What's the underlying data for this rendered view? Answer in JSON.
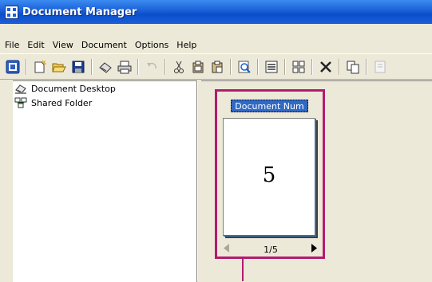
{
  "window": {
    "title": "Document Manager"
  },
  "menubar": {
    "items": [
      "File",
      "Edit",
      "View",
      "Document",
      "Options",
      "Help"
    ]
  },
  "toolbar": {
    "buttons": [
      {
        "icon": "app-blue-icon"
      },
      {
        "icon": "new-icon"
      },
      {
        "icon": "open-folder-icon"
      },
      {
        "icon": "save-icon"
      },
      {
        "icon": "scanner-icon"
      },
      {
        "icon": "print-icon"
      },
      {
        "icon": "undo-icon"
      },
      {
        "icon": "cut-icon"
      },
      {
        "icon": "copy-icon"
      },
      {
        "icon": "paste-icon"
      },
      {
        "icon": "zoom-icon"
      },
      {
        "icon": "list-view-icon"
      },
      {
        "icon": "thumbnail-view-icon"
      },
      {
        "icon": "delete-icon"
      },
      {
        "icon": "duplicate-icon"
      },
      {
        "icon": "properties-icon"
      }
    ]
  },
  "tree": {
    "items": [
      {
        "label": "Document Desktop",
        "icon": "desktop-icon"
      },
      {
        "label": "Shared Folder",
        "icon": "shared-folder-icon"
      }
    ]
  },
  "document": {
    "name": "Document Num",
    "page_number": "5",
    "page_count": "1/5"
  },
  "colors": {
    "title_bar": "#0a4fca",
    "highlight": "#b31b6f",
    "selection": "#316ac5"
  }
}
